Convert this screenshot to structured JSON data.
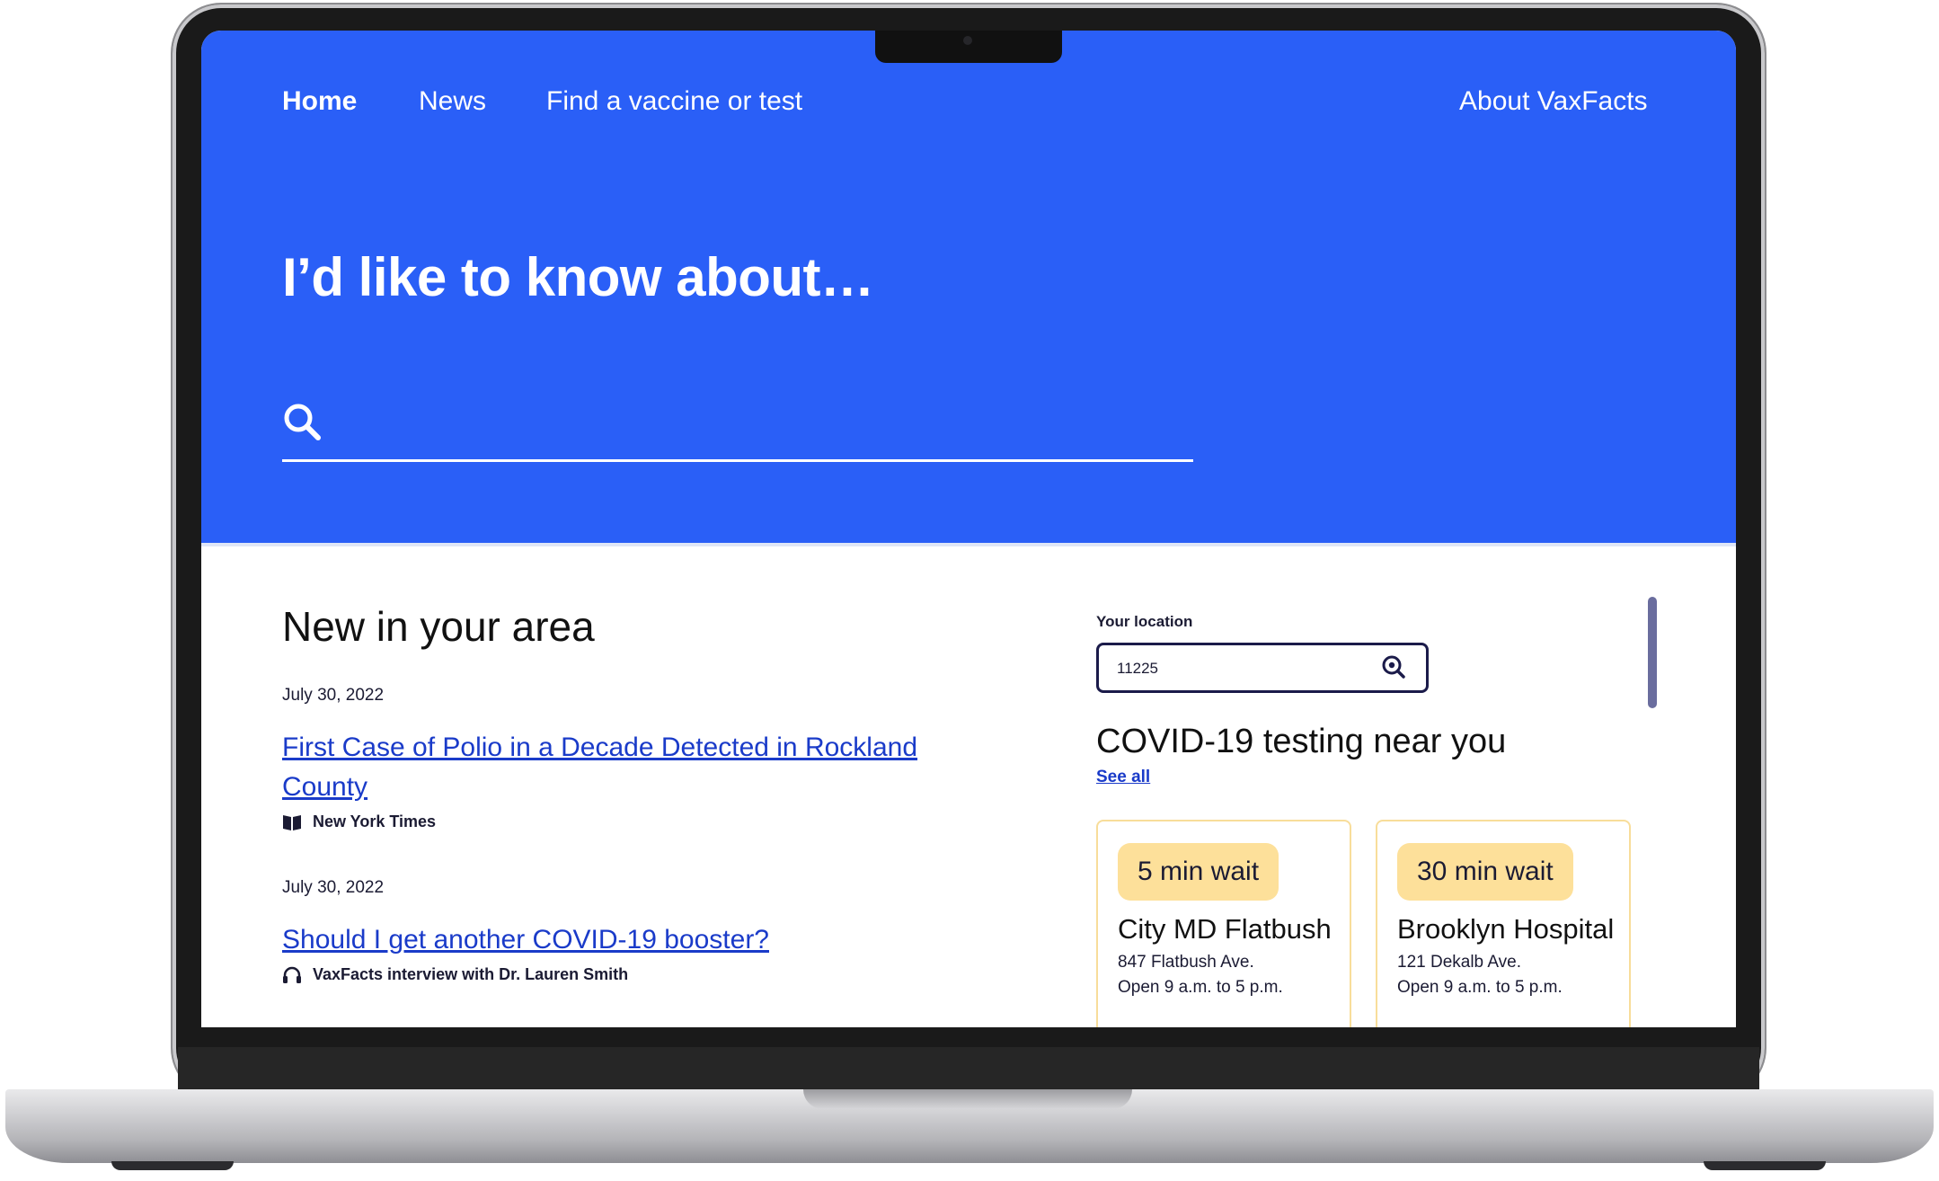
{
  "nav": {
    "home": "Home",
    "news": "News",
    "find": "Find a vaccine or test",
    "about": "About VaxFacts"
  },
  "hero": {
    "title": "I’d like to know about…",
    "search_value": ""
  },
  "news": {
    "section_title": "New in your area",
    "items": [
      {
        "date": "July 30, 2022",
        "title": "First Case of Polio in a Decade Detected in Rockland County",
        "source": "New York Times",
        "source_icon": "book-icon"
      },
      {
        "date": "July 30, 2022",
        "title": "Should I get another COVID-19 booster?",
        "source": "VaxFacts interview with Dr. Lauren Smith",
        "source_icon": "headphones-icon"
      }
    ]
  },
  "location": {
    "label": "Your location",
    "value": "11225"
  },
  "testing": {
    "title": "COVID-19 testing near you",
    "see_all": "See all",
    "sites": [
      {
        "wait": "5 min wait",
        "name": "City MD Flatbush",
        "address": "847 Flatbush Ave.",
        "hours": "Open 9 a.m. to 5 p.m."
      },
      {
        "wait": "30 min wait",
        "name": "Brooklyn Hospital",
        "address": "121 Dekalb Ave.",
        "hours": "Open 9 a.m. to 5 p.m."
      }
    ]
  },
  "colors": {
    "brand_blue": "#2a5ff7",
    "link_blue": "#1a3bc9",
    "badge_yellow": "#fde09a",
    "card_border": "#f8dd9a"
  }
}
